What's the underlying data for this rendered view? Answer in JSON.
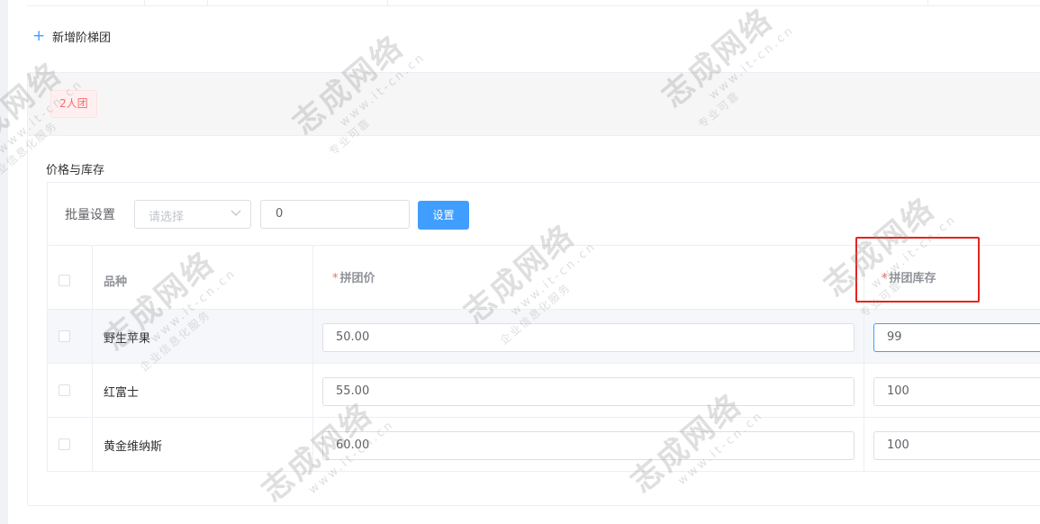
{
  "toolbar": {
    "add_group_label": "新增阶梯团",
    "add_icon_glyph": "+"
  },
  "group": {
    "tag_label": "2人团"
  },
  "section": {
    "title": "价格与库存"
  },
  "batch": {
    "label": "批量设置",
    "select_placeholder": "请选择",
    "value": "0",
    "set_button": "设置"
  },
  "table": {
    "columns": {
      "variety": "品种",
      "group_price": "拼团价",
      "group_stock": "拼团库存",
      "required_mark": "*"
    },
    "rows": [
      {
        "variety": "野生苹果",
        "price": "50.00",
        "stock": "99"
      },
      {
        "variety": "红富士",
        "price": "55.00",
        "stock": "100"
      },
      {
        "variety": "黄金维纳斯",
        "price": "60.00",
        "stock": "100"
      }
    ]
  },
  "watermark": {
    "brand": "志成网络",
    "url": "www.it-cn.cn",
    "tagline": "专业可靠",
    "sub": "企业信息化服务"
  },
  "colors": {
    "primary": "#409eff",
    "danger": "#f56c6c",
    "highlight_box": "#e6231d"
  }
}
